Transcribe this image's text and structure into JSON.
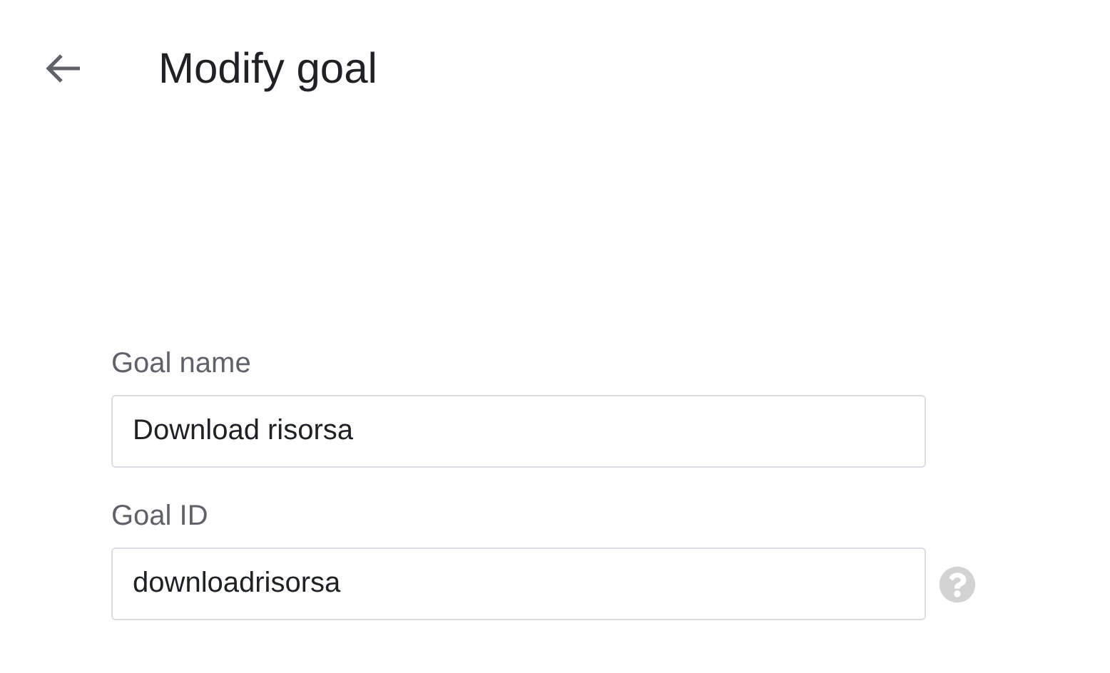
{
  "header": {
    "title": "Modify goal"
  },
  "fields": [
    {
      "label": "Goal name",
      "value": "Download risorsa",
      "help": false
    },
    {
      "label": "Goal ID",
      "value": "downloadrisorsa",
      "help": true
    }
  ]
}
